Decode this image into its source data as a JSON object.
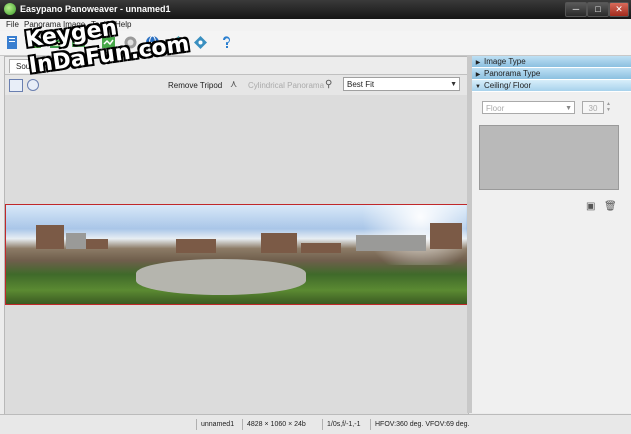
{
  "window": {
    "title": "Easypano Panoweaver - unnamed1",
    "minimize": "─",
    "maximize": "□",
    "close": "✕"
  },
  "menu": [
    "File",
    "Panorama",
    "Image",
    "Tools",
    "Help"
  ],
  "toolbar": {
    "icons": [
      "new-project-icon",
      "open-project-icon",
      "save-project-icon",
      "add-image-icon",
      "stitch-icon",
      "image-icon",
      "detect-icon",
      "globe-icon",
      "publish-icon",
      "settings-icon",
      "help-icon"
    ]
  },
  "left": {
    "tab": "Source",
    "remove_tripod": "Remove Tripod",
    "cylindrical": "Cylindrical Panorama",
    "fit_option": "Best Fit",
    "fit_arrow": "▼"
  },
  "right": {
    "sections": [
      {
        "label": "Image Type",
        "state": "collapsed"
      },
      {
        "label": "Panorama Type",
        "state": "collapsed"
      },
      {
        "label": "Ceiling/ Floor",
        "state": "expanded"
      }
    ],
    "floor_select": "Floor",
    "floor_value": "30",
    "add_icon": "▣",
    "delete_icon": "🗑"
  },
  "status": {
    "file": "unnamed1",
    "dimensions": "4828 × 1060 × 24b",
    "exposure": "1/0s,f/-1,-1",
    "fov": "HFOV:360 deg. VFOV:69 deg."
  },
  "watermark": {
    "line1": "Keygen",
    "line2": "InDaFun.com"
  },
  "colors": {
    "title_bar": "#1f1f1f",
    "section_header": "#9fcdea",
    "panorama_border": "#c0282a"
  }
}
